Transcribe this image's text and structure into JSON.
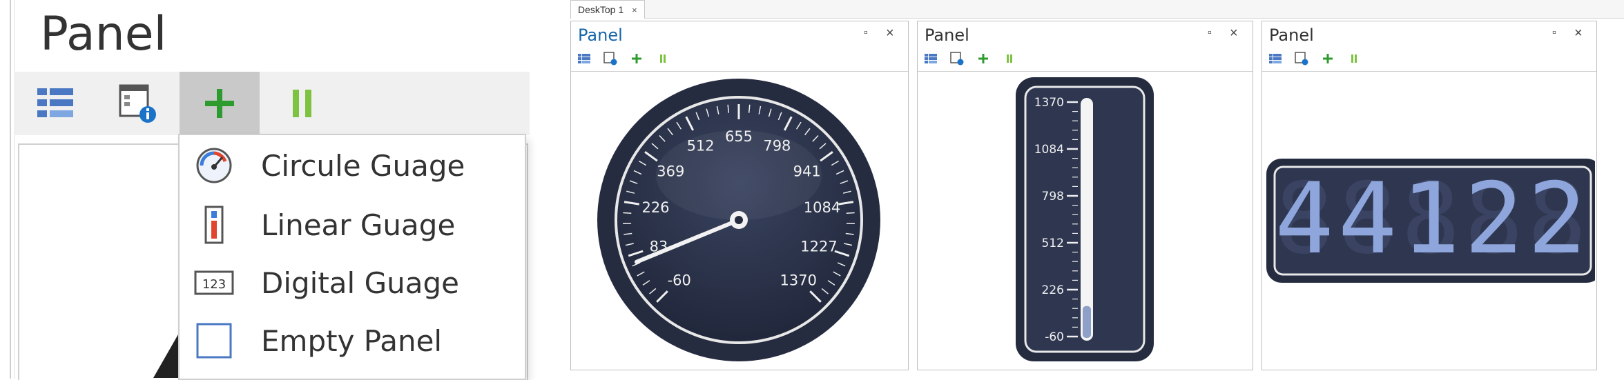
{
  "zoom": {
    "title": "Panel",
    "menu_items": [
      {
        "label": "Circule Guage",
        "icon": "circle-gauge-icon"
      },
      {
        "label": "Linear Guage",
        "icon": "linear-gauge-icon"
      },
      {
        "label": "Digital Guage",
        "icon": "digital-gauge-icon"
      },
      {
        "label": "Empty Panel",
        "icon": "empty-panel-icon"
      }
    ],
    "digital_icon_text": "123"
  },
  "desktop": {
    "tab_label": "DeskTop 1",
    "tab_close": "×",
    "panels": [
      {
        "title": "Panel",
        "title_color": "#1565a8"
      },
      {
        "title": "Panel",
        "title_color": "#333333"
      },
      {
        "title": "Panel",
        "title_color": "#333333"
      }
    ],
    "max_glyph": "▫",
    "close_glyph": "×"
  },
  "circle_gauge": {
    "tick_labels": [
      "-60",
      "83",
      "226",
      "369",
      "512",
      "655",
      "798",
      "941",
      "1084",
      "1227",
      "1370"
    ],
    "min": -60,
    "max": 1370,
    "value": 60
  },
  "linear_gauge": {
    "tick_labels": [
      "1370",
      "1084",
      "798",
      "512",
      "226",
      "-60"
    ],
    "min": -60,
    "max": 1370,
    "value": 0
  },
  "digital_gauge": {
    "value": "44122"
  },
  "colors": {
    "accent_green": "#2e9b2e",
    "pause_green": "#7ec241",
    "gauge_face": "#2a3148",
    "digit_color": "#8fa6dc"
  }
}
